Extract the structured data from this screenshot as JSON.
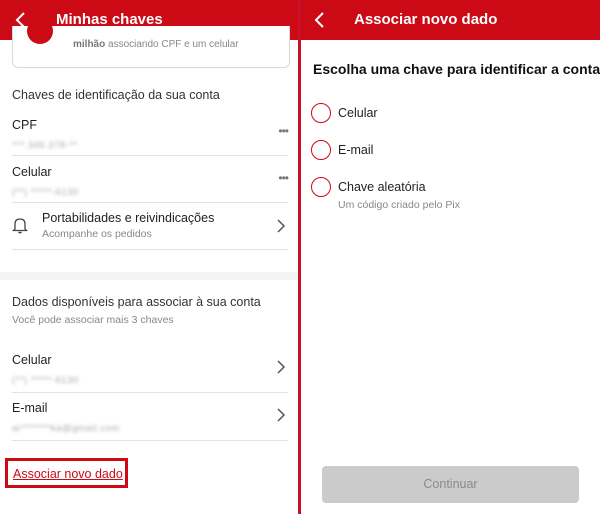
{
  "left": {
    "appbar": {
      "title": "Minhas chaves"
    },
    "top_card": {
      "text_bold": "milhão",
      "text_rest": " associando CPF e um celular"
    },
    "keys_section": {
      "title": "Chaves de identificação da sua conta"
    },
    "keys": [
      {
        "label": "CPF",
        "masked": "***.346.378-**"
      },
      {
        "label": "Celular",
        "masked": "(**) *****-6130"
      }
    ],
    "portability": {
      "label": "Portabilidades e reivindicações",
      "sub": "Acompanhe os pedidos"
    },
    "available_section": {
      "title": "Dados disponíveis para associar à sua conta",
      "sub": "Você pode associar mais 3 chaves"
    },
    "available": [
      {
        "label": "Celular",
        "masked": "(**) *****-6130"
      },
      {
        "label": "E-mail",
        "masked": "ar*******ka@gmail.com"
      }
    ],
    "associate_link": "Associar novo dado"
  },
  "right": {
    "appbar": {
      "title": "Associar novo dado"
    },
    "heading": "Escolha uma chave para identificar a conta",
    "options": [
      {
        "label": "Celular"
      },
      {
        "label": "E-mail"
      },
      {
        "label": "Chave aleatória",
        "sub": "Um código criado pelo Pix"
      }
    ],
    "continue_label": "Continuar"
  },
  "colors": {
    "brand_red": "#cc0a16",
    "disabled_button": "#cbcbcb"
  },
  "icons": [
    "back-arrow-icon",
    "more-dots-icon",
    "bell-icon",
    "chevron-right-icon"
  ]
}
